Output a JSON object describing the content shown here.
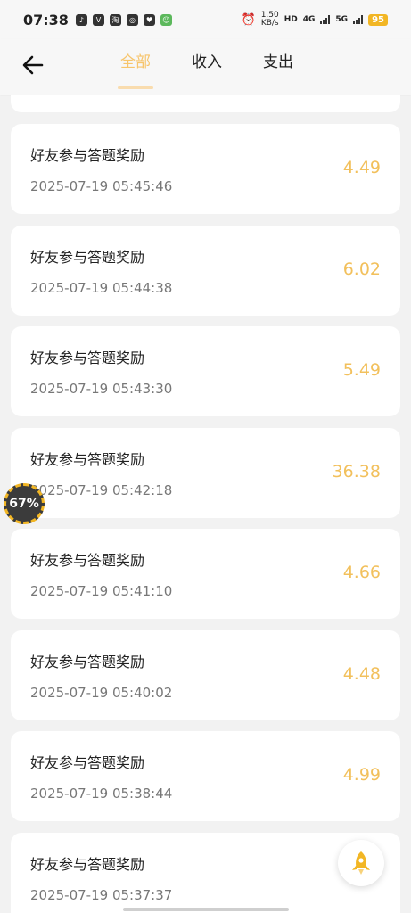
{
  "status_bar": {
    "time": "07:38",
    "net_speed": "1.50",
    "net_unit": "KB/s",
    "hd_label": "HD",
    "sim1": "4G",
    "sim2": "5G",
    "battery": "95"
  },
  "header": {
    "tabs": [
      {
        "label": "全部",
        "active": true
      },
      {
        "label": "收入",
        "active": false
      },
      {
        "label": "支出",
        "active": false
      }
    ]
  },
  "records": [
    {
      "title": "好友参与答题奖励",
      "date": "2025-07-19 05:45:46",
      "amount": "4.49"
    },
    {
      "title": "好友参与答题奖励",
      "date": "2025-07-19 05:44:38",
      "amount": "6.02"
    },
    {
      "title": "好友参与答题奖励",
      "date": "2025-07-19 05:43:30",
      "amount": "5.49"
    },
    {
      "title": "好友参与答题奖励",
      "date": "2025-07-19 05:42:18",
      "amount": "36.38"
    },
    {
      "title": "好友参与答题奖励",
      "date": "2025-07-19 05:41:10",
      "amount": "4.66"
    },
    {
      "title": "好友参与答题奖励",
      "date": "2025-07-19 05:40:02",
      "amount": "4.48"
    },
    {
      "title": "好友参与答题奖励",
      "date": "2025-07-19 05:38:44",
      "amount": "4.99"
    },
    {
      "title": "好友参与答题奖励",
      "date": "2025-07-19 05:37:37",
      "amount": ""
    }
  ],
  "floating_badge": "67%",
  "accent_color": "#f2c05c"
}
